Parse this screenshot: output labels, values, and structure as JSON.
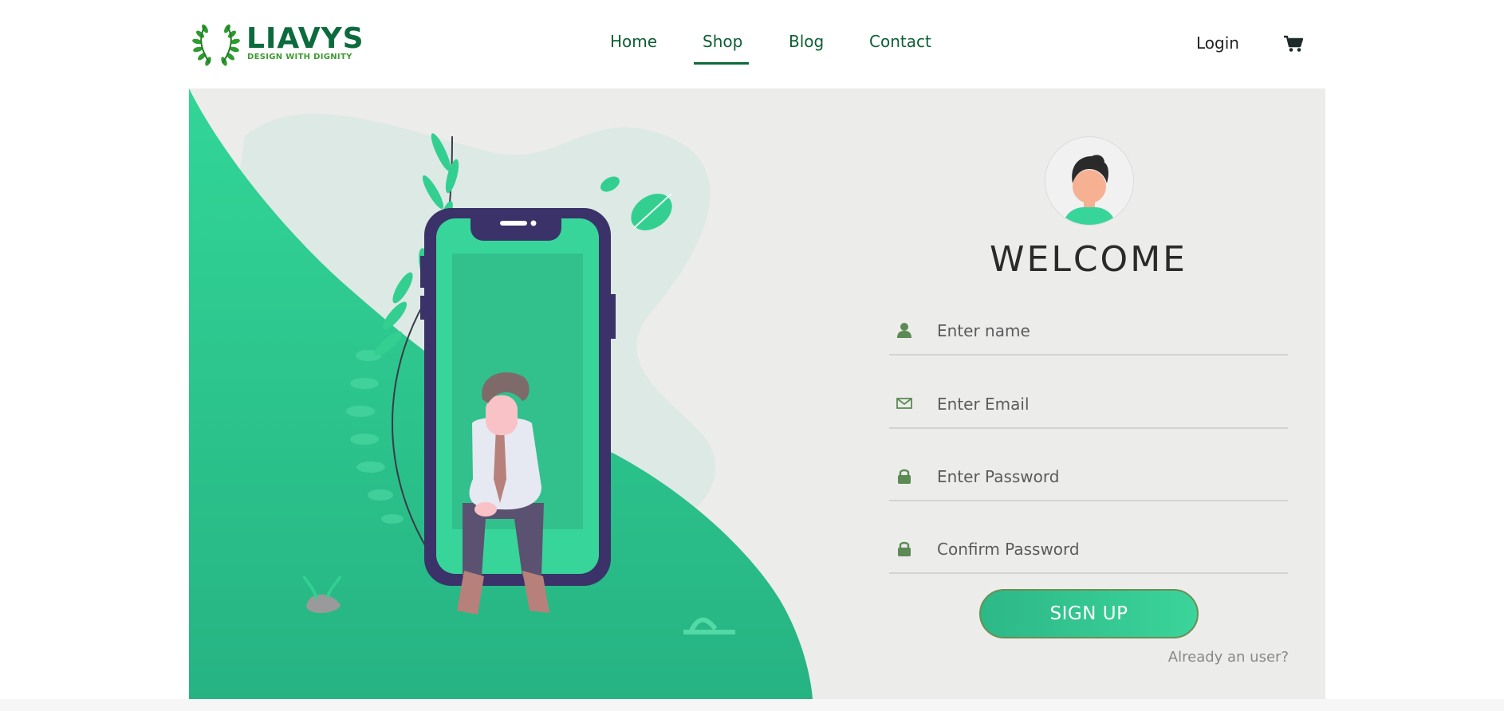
{
  "brand": {
    "name": "LIAVYS",
    "tagline": "DESIGN WITH DIGNITY",
    "logo_icon": "laurel-wreath-icon"
  },
  "nav": {
    "links": [
      {
        "label": "Home"
      },
      {
        "label": "Shop",
        "active": true
      },
      {
        "label": "Blog"
      },
      {
        "label": "Contact"
      }
    ],
    "login_label": "Login",
    "cart_icon": "shopping-cart-icon"
  },
  "form": {
    "avatar_icon": "user-avatar-icon",
    "title": "WELCOME",
    "fields": [
      {
        "icon": "user-icon",
        "placeholder": "Enter name",
        "value": ""
      },
      {
        "icon": "envelope-icon",
        "placeholder": "Enter Email",
        "value": ""
      },
      {
        "icon": "lock-icon",
        "placeholder": "Enter Password",
        "value": ""
      },
      {
        "icon": "lock-icon",
        "placeholder": "Confirm Password",
        "value": ""
      }
    ],
    "submit_label": "SIGN UP",
    "already_user_link": "Already an user?"
  },
  "colors": {
    "brand_green": "#0c6b3c",
    "accent_green": "#2fd093",
    "phone_frame": "#3a3268",
    "card_bg": "#ececea"
  }
}
